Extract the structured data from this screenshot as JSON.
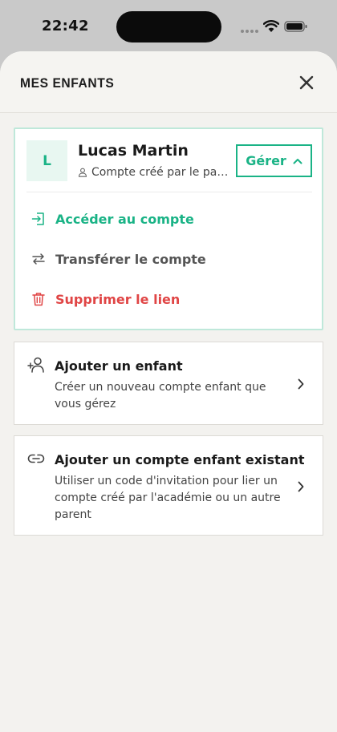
{
  "status_bar": {
    "time": "22:42"
  },
  "sheet": {
    "title": "MES ENFANTS",
    "close_icon": "close-icon"
  },
  "child": {
    "initial": "L",
    "name": "Lucas Martin",
    "subtitle": "Compte créé par le parent",
    "manage_label": "Gérer",
    "actions": [
      {
        "label": "Accéder au compte",
        "icon": "login-icon",
        "color": "#1ab386"
      },
      {
        "label": "Transférer le compte",
        "icon": "transfer-icon",
        "color": "#555555"
      },
      {
        "label": "Supprimer le lien",
        "icon": "trash-icon",
        "color": "#e04545"
      }
    ]
  },
  "options": [
    {
      "title": "Ajouter un enfant",
      "description": "Créer un nouveau compte enfant que vous gérez",
      "icon": "add-user-icon"
    },
    {
      "title": "Ajouter un compte enfant existant",
      "description": "Utiliser un code d'invitation pour lier un compte créé par l'académie ou un autre parent",
      "icon": "link-icon"
    }
  ],
  "colors": {
    "accent": "#1ab386",
    "danger": "#e04545",
    "background": "#f3f2ef"
  }
}
